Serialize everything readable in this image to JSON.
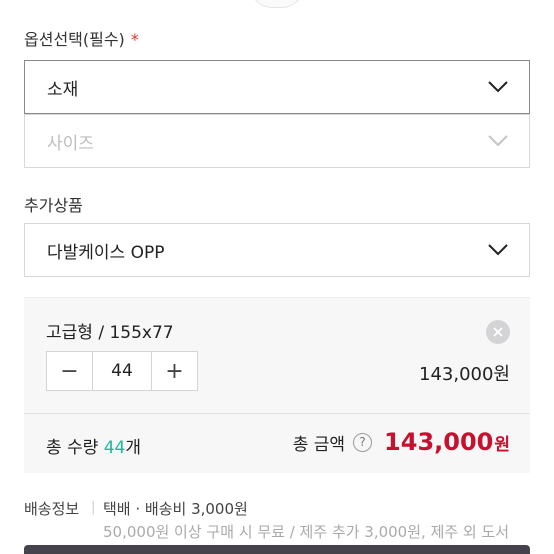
{
  "option_select": {
    "label": "옵션선택(필수)",
    "required_mark": "*",
    "selects": [
      {
        "value": "소재",
        "state": "active"
      },
      {
        "value": "사이즈",
        "state": "disabled"
      }
    ]
  },
  "addon": {
    "label": "추가상품",
    "select_value": "다발케이스 OPP"
  },
  "selected_option": {
    "name": "고급형 / 155x77",
    "minus": "−",
    "plus": "+",
    "quantity": "44",
    "price": "143,000원"
  },
  "totals": {
    "qty_prefix": "총 수량 ",
    "qty_value": "44",
    "qty_suffix": "개",
    "amount_label": "총 금액",
    "help": "?",
    "amount_value": "143,000",
    "amount_unit": "원",
    "accent_color": "#1fb897",
    "price_color": "#c8102e"
  },
  "shipping": {
    "label": "배송정보",
    "separator": "|",
    "main": "택배 · 배송비 3,000원",
    "sub": "50,000원 이상 구매 시 무료 / 제주 추가 3,000원, 제주 외 도서"
  }
}
